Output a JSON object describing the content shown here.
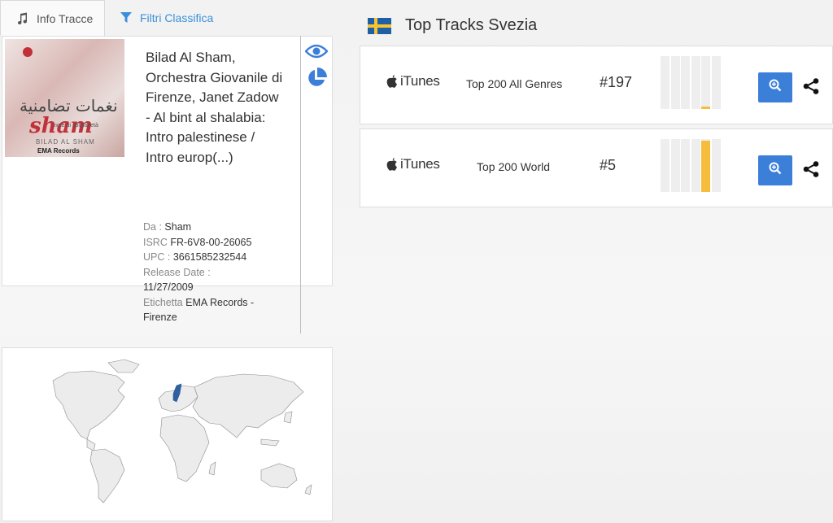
{
  "tabs": {
    "info_label": "Info Tracce",
    "filter_label": "Filtri Classifica"
  },
  "track": {
    "title": "Bilad Al Sham, Orchestra Giovanile di Firenze, Janet Zadow - Al bint al shalabia: Intro palestinese / Intro europ(...)",
    "cover": {
      "arabic": "نغمات تضامنية",
      "sham": "sham",
      "sub": "note di solidarietà",
      "bilad": "BILAD AL SHAM",
      "ema": "EMA Records"
    },
    "meta": {
      "da_label": "Da :",
      "da_value": "Sham",
      "isrc_label": "ISRC",
      "isrc_value": "FR-6V8-00-26065",
      "upc_label": "UPC :",
      "upc_value": "3661585232544",
      "release_label": "Release Date :",
      "release_value": "11/27/2009",
      "label_label": "Etichetta",
      "label_value": "EMA Records - Firenze"
    }
  },
  "icons": {
    "music": "music-note-icon",
    "filter": "filter-icon",
    "eye": "eye-icon",
    "pie": "pie-chart-icon",
    "zoom": "zoom-in-icon",
    "share": "share-icon",
    "apple": "apple-icon"
  },
  "header": {
    "title": "Top Tracks Svezia",
    "flag": "sweden-flag"
  },
  "charts": [
    {
      "platform": "iTunes",
      "name": "Top 200 All Genres",
      "rank": "#197",
      "history": [
        0,
        0,
        0,
        0,
        0.04,
        0
      ]
    },
    {
      "platform": "iTunes",
      "name": "Top 200 World",
      "rank": "#5",
      "history": [
        0,
        0,
        0,
        0,
        0.97,
        0
      ]
    }
  ],
  "colors": {
    "accent": "#3b7fd9",
    "bar_fill": "#f6bd3c",
    "map_highlight": "#2f5f9e",
    "flag_blue": "#1f5fa6",
    "flag_yellow": "#f6c431"
  }
}
